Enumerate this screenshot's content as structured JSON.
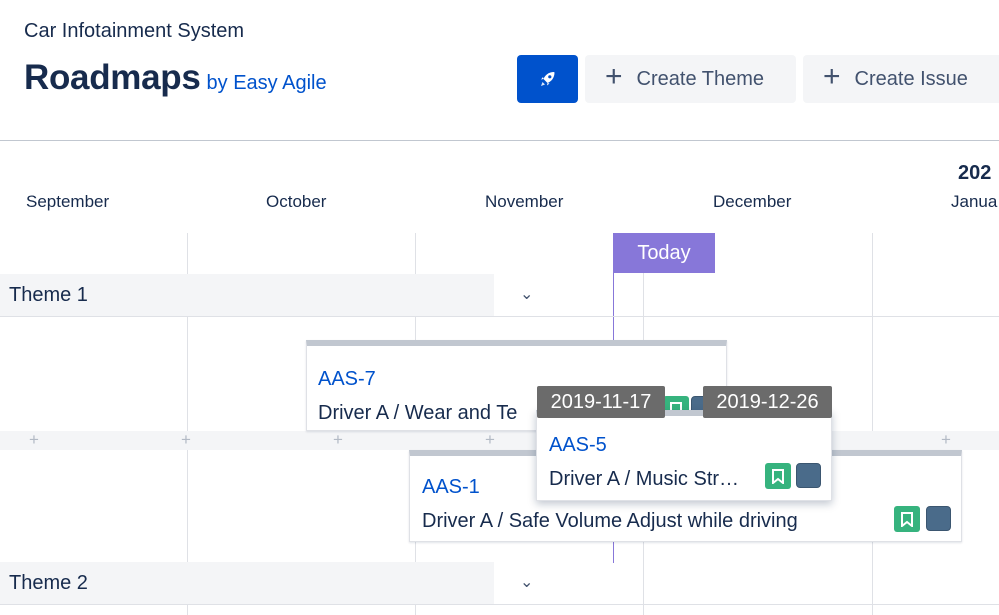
{
  "header": {
    "project_name": "Car Infotainment System",
    "title": "Roadmaps",
    "by_label": "by Easy Agile",
    "rocket_icon": "rocket-icon",
    "create_theme_label": "Create Theme",
    "create_issue_label": "Create Issue",
    "accent_color": "#0052cc"
  },
  "timeline": {
    "year": "202",
    "months": [
      "September",
      "October",
      "November",
      "December",
      "Janua"
    ],
    "today_label": "Today",
    "today_color": "#8777d9"
  },
  "themes": [
    {
      "name": "Theme 1"
    },
    {
      "name": "Theme 2"
    }
  ],
  "cards": [
    {
      "key": "AAS-7",
      "summary": "Driver A / Wear and Te"
    },
    {
      "key": "AAS-5",
      "summary": "Driver A / Music Str…",
      "start_date": "2019-11-17",
      "end_date": "2019-12-26"
    },
    {
      "key": "AAS-1",
      "summary": "Driver A / Safe Volume Adjust while driving"
    }
  ],
  "icons": {
    "story": "bookmark-icon",
    "status": "status-square-icon",
    "story_color": "#36b37e",
    "status_color": "#4a6b8a"
  }
}
